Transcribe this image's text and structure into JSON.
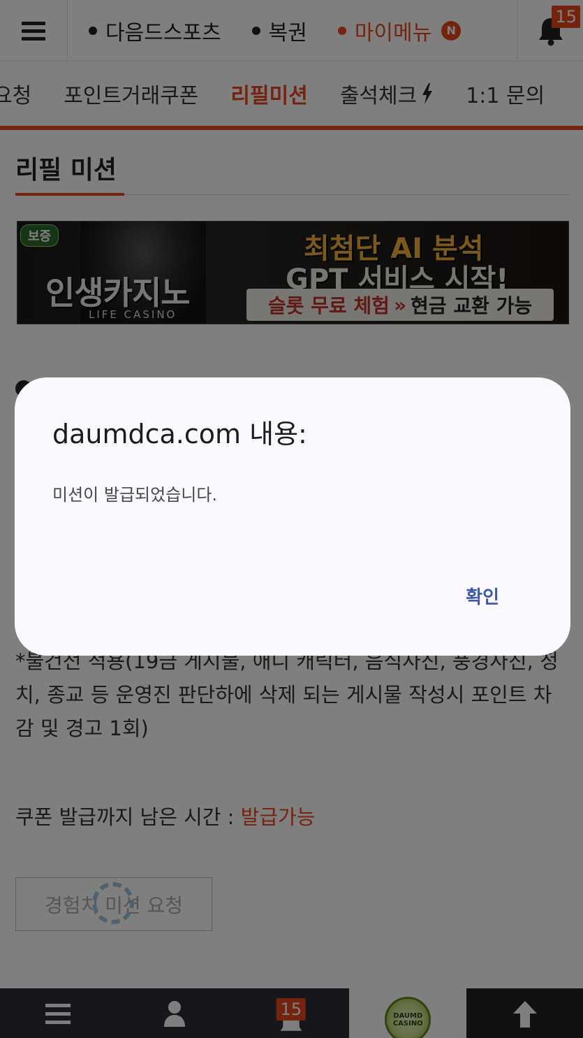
{
  "topbar": {
    "links": [
      {
        "label": "다음드스포츠",
        "active": false
      },
      {
        "label": "복권",
        "active": false
      },
      {
        "label": "마이메뉴",
        "active": true,
        "badge": "N"
      }
    ],
    "notification_count": "15"
  },
  "subnav": {
    "items": [
      {
        "label": "요청",
        "active": false
      },
      {
        "label": "포인트거래쿠폰",
        "active": false
      },
      {
        "label": "리필미션",
        "active": true
      },
      {
        "label": "출석체크",
        "active": false,
        "icon": "lightning-icon"
      },
      {
        "label": "1:1 문의",
        "active": false
      }
    ]
  },
  "page": {
    "title": "리필 미션"
  },
  "banner": {
    "verified": "보증",
    "brand_ko": "인생카지노",
    "brand_en": "LIFE CASINO",
    "headline1": "최첨단 AI 분석",
    "headline2": "GPT 서비스 시작!",
    "cta_left": "슬롯 무료 체험",
    "cta_sep": "»",
    "cta_right": "현금 교환 가능"
  },
  "content": {
    "rule_text": "*불건전 적용(19금 게시물, 애니 캐릭터, 음식사진, 풍경사진, 정치, 종교 등 운영진 판단하에 삭제 되는 게시물 작성시 포인트 차감 및 경고 1회)",
    "timer_label": "쿠폰 발급까지 남은 시간 : ",
    "timer_value": "발급가능",
    "request_button": "경험치 미션 요청"
  },
  "bottombar": {
    "notification_count": "15",
    "logo_text": "DAUMD CASINO"
  },
  "dialog": {
    "title": "daumdca.com 내용:",
    "message": "미션이 발급되었습니다.",
    "ok_label": "확인"
  },
  "colors": {
    "accent": "#e8491d",
    "dialog_button": "#3e5ba8"
  }
}
